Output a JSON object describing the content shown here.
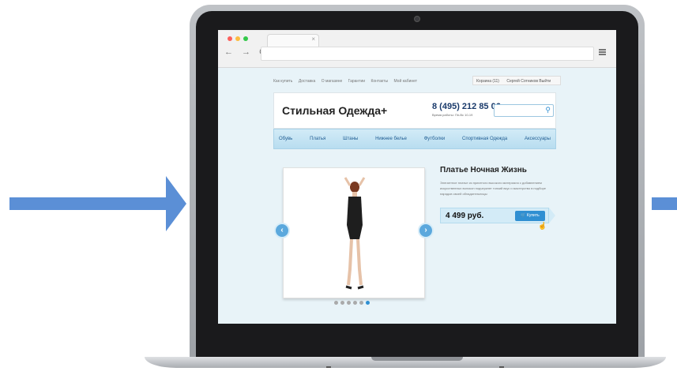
{
  "browser": {
    "tab_close": "×",
    "nav": "← → C"
  },
  "site": {
    "top_links": [
      "Как купить",
      "Доставка",
      "О магазине",
      "Гарантии",
      "Контакты",
      "Мой кабинет"
    ],
    "cart_label": "Корзина (11)",
    "user_label": "Сергей Сотников Выйти",
    "logo": "Стильная Одежда+",
    "phone": "8 (495) 212 85 06",
    "hours": "Время работы: Пн-Вс 10-19",
    "menu": [
      "Обувь",
      "Платья",
      "Штаны",
      "Нижнее белье",
      "Футболки",
      "Спортивная Одежда",
      "Аксессуары"
    ],
    "slider": {
      "prev_label": "‹",
      "next_label": "›",
      "dots_count": 6,
      "active_dot": 6
    },
    "product": {
      "title": "Платье Ночная Жизнь",
      "description": "Элегантное платье из приятного высокого материала с добавлением искусственных волокон подчеркнет тонкий вкус и мастерство в подборе нарядов своей обладательницы",
      "price": "4 499 руб.",
      "buy_label": "Купить"
    }
  },
  "colors": {
    "arrow": "#5b8fd6",
    "accent": "#2f8fd2",
    "menu_text": "#1f5c92"
  }
}
